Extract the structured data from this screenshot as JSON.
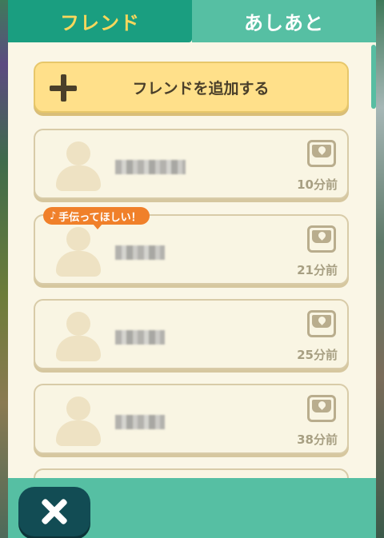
{
  "tabs": {
    "friends": "フレンド",
    "footprints": "あしあと"
  },
  "add_friend": {
    "label": "フレンドを追加する",
    "icon": "plus-icon"
  },
  "friends": [
    {
      "time": "10分前",
      "request": ""
    },
    {
      "time": "21分前",
      "request": "手伝ってほしい！"
    },
    {
      "time": "25分前",
      "request": ""
    },
    {
      "time": "38分前",
      "request": ""
    }
  ],
  "icons": {
    "mailbox": "mailbox-icon",
    "avatar": "avatar-silhouette",
    "close": "close-icon",
    "note": "music-note-icon"
  },
  "colors": {
    "active_tab": "#1a9e80",
    "active_tab_text": "#f9d75c",
    "inactive_tab": "#56bfa3",
    "add_button": "#ffe08a",
    "request_badge": "#f0802a",
    "close_button": "#124c54"
  }
}
